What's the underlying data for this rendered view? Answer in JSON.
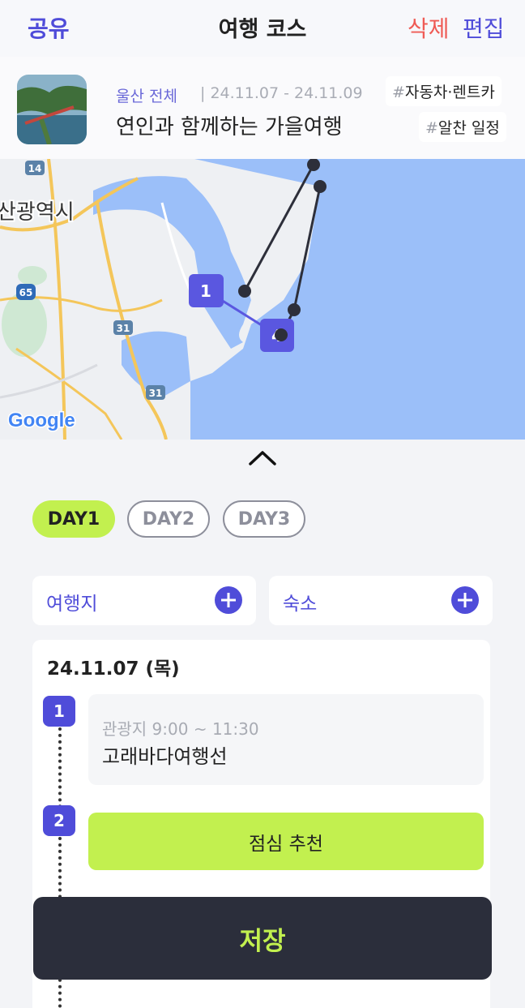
{
  "header": {
    "share_label": "공유",
    "title": "여행 코스",
    "delete_label": "삭제",
    "edit_label": "편집"
  },
  "trip": {
    "region": "울산 전체",
    "dates": "24.11.07 - 24.11.09",
    "title": "연인과 함께하는 가을여행",
    "tags": [
      {
        "hash": "#",
        "text": "자동차·렌트카"
      },
      {
        "hash": "#",
        "text": "알찬 일정"
      }
    ]
  },
  "map": {
    "city_label": "산광역시",
    "road_labels": [
      "14",
      "65",
      "31",
      "31"
    ],
    "google_logo": "Google",
    "route_markers": [
      "1",
      "4"
    ],
    "colors": {
      "water": "#9bbff9",
      "land": "#eef0f3",
      "route": "#5a57e0",
      "line": "#2d2f3a"
    }
  },
  "days": {
    "tabs": [
      "DAY1",
      "DAY2",
      "DAY3"
    ],
    "active": "DAY1"
  },
  "add": {
    "destination_label": "여행지",
    "stay_label": "숙소"
  },
  "itinerary": {
    "date": "24.11.07 (목)",
    "items": [
      {
        "number": "1",
        "meta": "관광지 9:00 ~ 11:30",
        "name": "고래바다여행선"
      },
      {
        "number": "2",
        "label": "점심 추천"
      }
    ]
  },
  "save_label": "저장",
  "colors": {
    "accent": "#4f4cd9",
    "lime": "#c2f04f",
    "danger": "#ef5b55",
    "dark": "#2b2e3b"
  }
}
